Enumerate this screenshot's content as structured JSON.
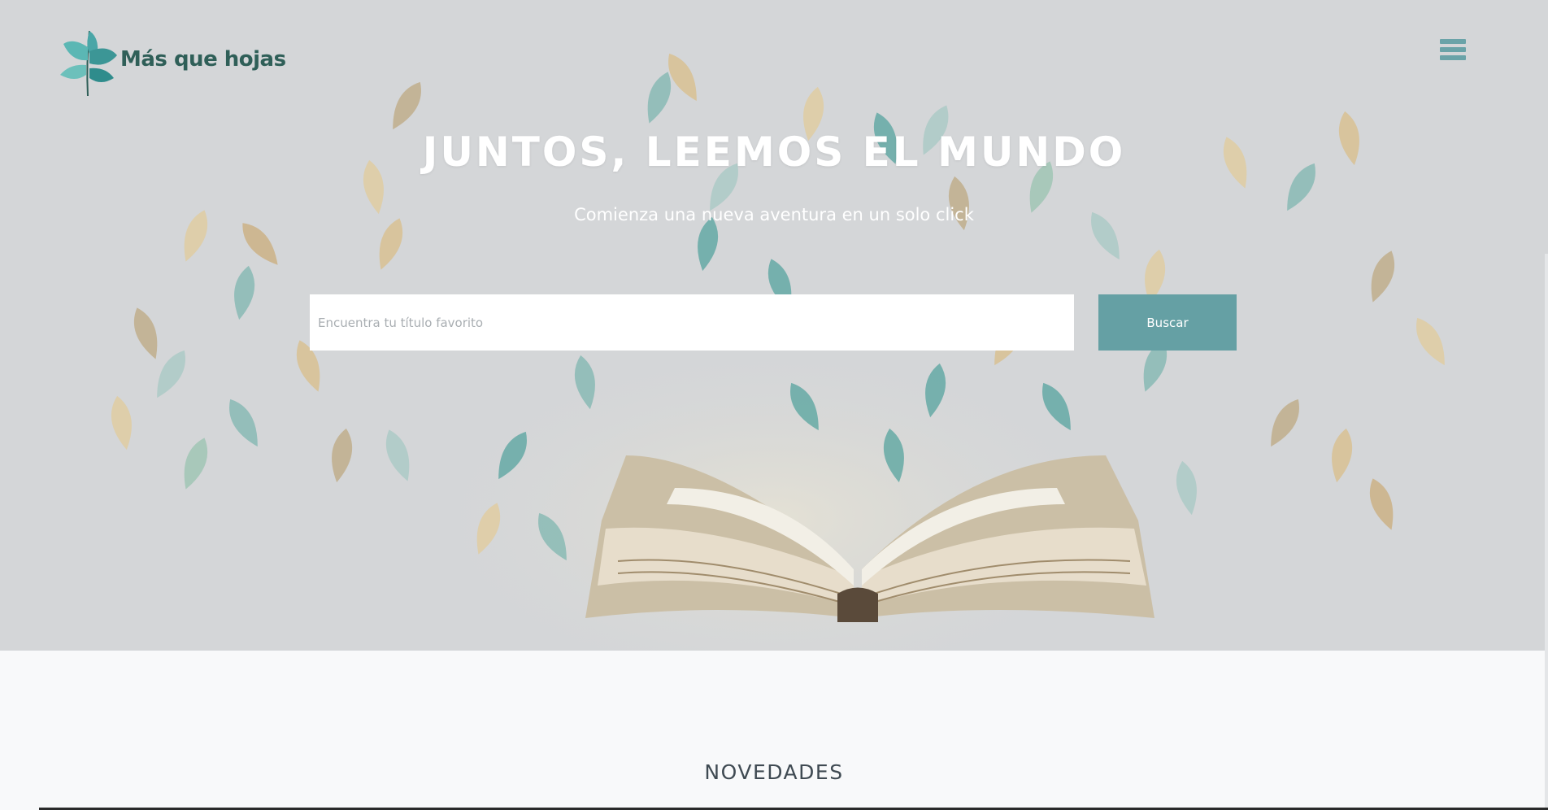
{
  "brand": {
    "name": "Más que hojas",
    "colors": {
      "accent": "#65a0a4",
      "logo_text": "#2f5f58",
      "hero_bg": "#d4d6d8"
    }
  },
  "nav": {
    "menu_icon": "hamburger-menu-icon"
  },
  "hero": {
    "title": "JUNTOS, LEEMOS EL MUNDO",
    "subtitle": "Comienza una nueva aventura en un solo click",
    "search": {
      "placeholder": "Encuentra tu título favorito",
      "value": "",
      "button_label": "Buscar"
    }
  },
  "sections": {
    "novedades": {
      "title": "NOVEDADES"
    }
  }
}
